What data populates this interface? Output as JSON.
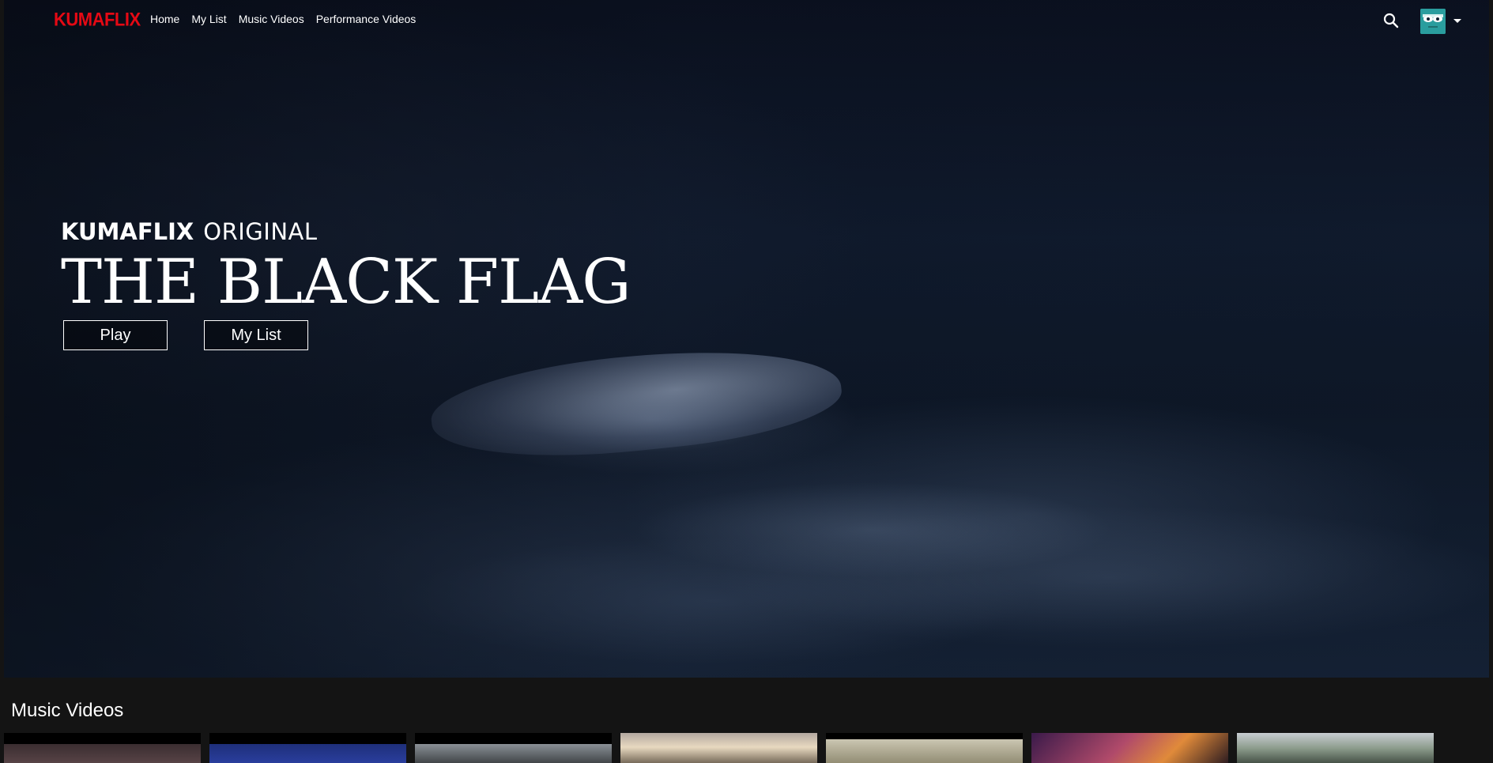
{
  "brand": {
    "logo_text": "KUMAFLIX",
    "accent_color": "#e50914"
  },
  "nav": {
    "links": [
      {
        "label": "Home"
      },
      {
        "label": "My List"
      },
      {
        "label": "Music Videos"
      },
      {
        "label": "Performance Videos"
      }
    ],
    "search_icon": "search-icon",
    "profile_icon": "avatar",
    "caret_icon": "caret-down-icon"
  },
  "hero": {
    "brand_word": "KUMAFLIX",
    "original_word": "ORIGINAL",
    "title": "THE BLACK FLAG",
    "play_label": "Play",
    "mylist_label": "My List"
  },
  "rows": [
    {
      "title": "Music Videos",
      "thumbnail_count": 7
    }
  ],
  "colors": {
    "background": "#141414",
    "text": "#ffffff",
    "avatar_bg": "#2a9d9e"
  }
}
